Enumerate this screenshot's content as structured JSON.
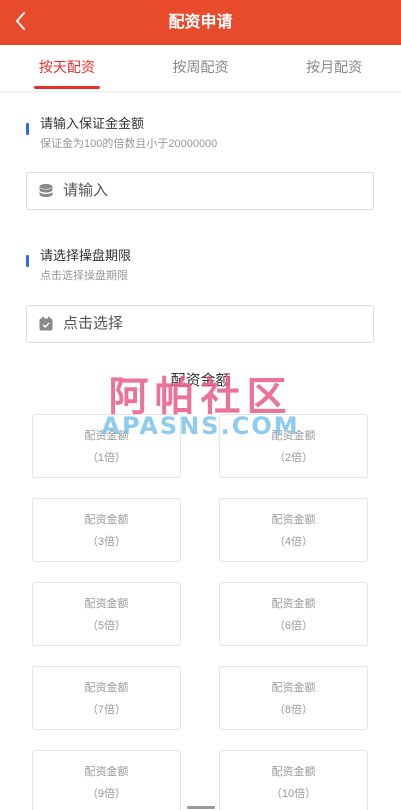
{
  "header": {
    "title": "配资申请"
  },
  "tabs": [
    {
      "label": "按天配资"
    },
    {
      "label": "按周配资"
    },
    {
      "label": "按月配资"
    }
  ],
  "deposit": {
    "title": "请输入保证金金额",
    "hint": "保证金为100的倍数且小于20000000",
    "placeholder": "请输入",
    "icon": "coins-icon"
  },
  "period": {
    "title": "请选择操盘期限",
    "hint": "点击选择操盘期限",
    "value": "点击选择",
    "icon": "calendar-icon"
  },
  "grid": {
    "title": "配资金额",
    "cards": [
      {
        "label": "配资金额",
        "multiple": "（1倍）"
      },
      {
        "label": "配资金额",
        "multiple": "（2倍）"
      },
      {
        "label": "配资金额",
        "multiple": "（3倍）"
      },
      {
        "label": "配资金额",
        "multiple": "（4倍）"
      },
      {
        "label": "配资金额",
        "multiple": "（5倍）"
      },
      {
        "label": "配资金额",
        "multiple": "（6倍）"
      },
      {
        "label": "配资金额",
        "multiple": "（7倍）"
      },
      {
        "label": "配资金额",
        "multiple": "（8倍）"
      },
      {
        "label": "配资金额",
        "multiple": "（9倍）"
      },
      {
        "label": "配资金额",
        "multiple": "（10倍）"
      }
    ]
  },
  "watermark": {
    "cn": "阿帕社区",
    "en": "APASNS.COM"
  },
  "colors": {
    "header": "#e84a2c",
    "active_tab": "#e8302a",
    "section_bar": "#2d6ce8"
  }
}
